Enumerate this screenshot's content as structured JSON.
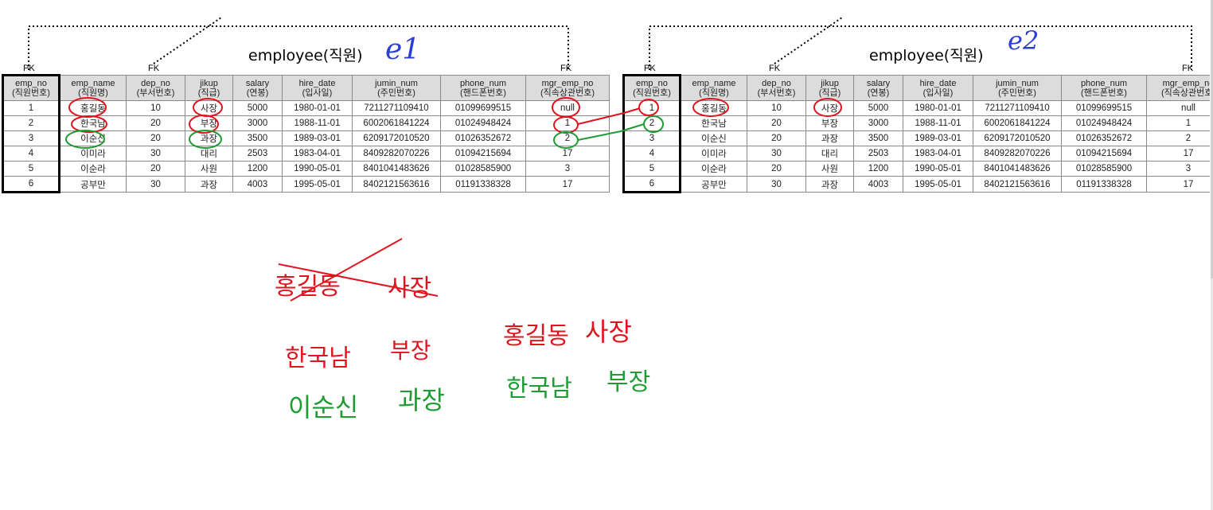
{
  "left": {
    "title": "employee(직원)",
    "pk_label": "PK",
    "fk_dep_label": "FK",
    "fk_mgr_label": "FK",
    "headers": [
      {
        "name": "emp_no",
        "sub": "(직원번호)"
      },
      {
        "name": "emp_name",
        "sub": "(직원명)"
      },
      {
        "name": "dep_no",
        "sub": "(부서번호)"
      },
      {
        "name": "jikup",
        "sub": "(직급)"
      },
      {
        "name": "salary",
        "sub": "(연봉)"
      },
      {
        "name": "hire_date",
        "sub": "(입사일)"
      },
      {
        "name": "jumin_num",
        "sub": "(주민번호)"
      },
      {
        "name": "phone_num",
        "sub": "(핸드폰번호)"
      },
      {
        "name": "mgr_emp_no",
        "sub": "(직속상관번호)"
      }
    ],
    "rows": [
      [
        "1",
        "홍길동",
        "10",
        "사장",
        "5000",
        "1980-01-01",
        "7211271109410",
        "01099699515",
        "null"
      ],
      [
        "2",
        "한국남",
        "20",
        "부장",
        "3000",
        "1988-11-01",
        "6002061841224",
        "01024948424",
        "1"
      ],
      [
        "3",
        "이순신",
        "20",
        "과장",
        "3500",
        "1989-03-01",
        "6209172010520",
        "01026352672",
        "2"
      ],
      [
        "4",
        "이미라",
        "30",
        "대리",
        "2503",
        "1983-04-01",
        "8409282070226",
        "01094215694",
        "17"
      ],
      [
        "5",
        "이순라",
        "20",
        "사원",
        "1200",
        "1990-05-01",
        "8401041483626",
        "01028585900",
        "3"
      ],
      [
        "6",
        "공부만",
        "30",
        "과장",
        "4003",
        "1995-05-01",
        "8402121563616",
        "01191338328",
        "17"
      ]
    ]
  },
  "right": {
    "title": "employee(직원)",
    "pk_label": "PK",
    "fk_dep_label": "FK",
    "fk_mgr_label": "FK",
    "headers": [
      {
        "name": "emp_no",
        "sub": "(직원번호)"
      },
      {
        "name": "emp_name",
        "sub": "(직원명)"
      },
      {
        "name": "dep_no",
        "sub": "(부서번호)"
      },
      {
        "name": "jikup",
        "sub": "(직급)"
      },
      {
        "name": "salary",
        "sub": "(연봉)"
      },
      {
        "name": "hire_date",
        "sub": "(입사일)"
      },
      {
        "name": "jumin_num",
        "sub": "(주민번호)"
      },
      {
        "name": "phone_num",
        "sub": "(핸드폰번호)"
      },
      {
        "name": "mgr_emp_no",
        "sub": "(직속상관번호)"
      }
    ],
    "rows": [
      [
        "1",
        "홍길동",
        "10",
        "사장",
        "5000",
        "1980-01-01",
        "7211271109410",
        "01099699515",
        "null"
      ],
      [
        "2",
        "한국남",
        "20",
        "부장",
        "3000",
        "1988-11-01",
        "6002061841224",
        "01024948424",
        "1"
      ],
      [
        "3",
        "이순신",
        "20",
        "과장",
        "3500",
        "1989-03-01",
        "6209172010520",
        "01026352672",
        "2"
      ],
      [
        "4",
        "이미라",
        "30",
        "대리",
        "2503",
        "1983-04-01",
        "8409282070226",
        "01094215694",
        "17"
      ],
      [
        "5",
        "이순라",
        "20",
        "사원",
        "1200",
        "1990-05-01",
        "8401041483626",
        "01028585900",
        "3"
      ],
      [
        "6",
        "공부만",
        "30",
        "과장",
        "4003",
        "1995-05-01",
        "8402121563616",
        "01191338328",
        "17"
      ]
    ]
  },
  "annotations": {
    "e1_label": "e1",
    "e2_label": "e2",
    "crossed_name": "홍길동",
    "crossed_title": "사장",
    "pair1_name": "한국남",
    "pair1_title": "부장",
    "pair2_name": "이순신",
    "pair2_title": "과장",
    "pair3_name": "홍길동",
    "pair3_title": "사장",
    "pair4_name": "한국남",
    "pair4_title": "부장"
  },
  "colors": {
    "red_ink": "#e0141e",
    "green_ink": "#1e9b32",
    "blue_ink": "#2b3fd6",
    "header_bg": "#dcdcdc"
  }
}
